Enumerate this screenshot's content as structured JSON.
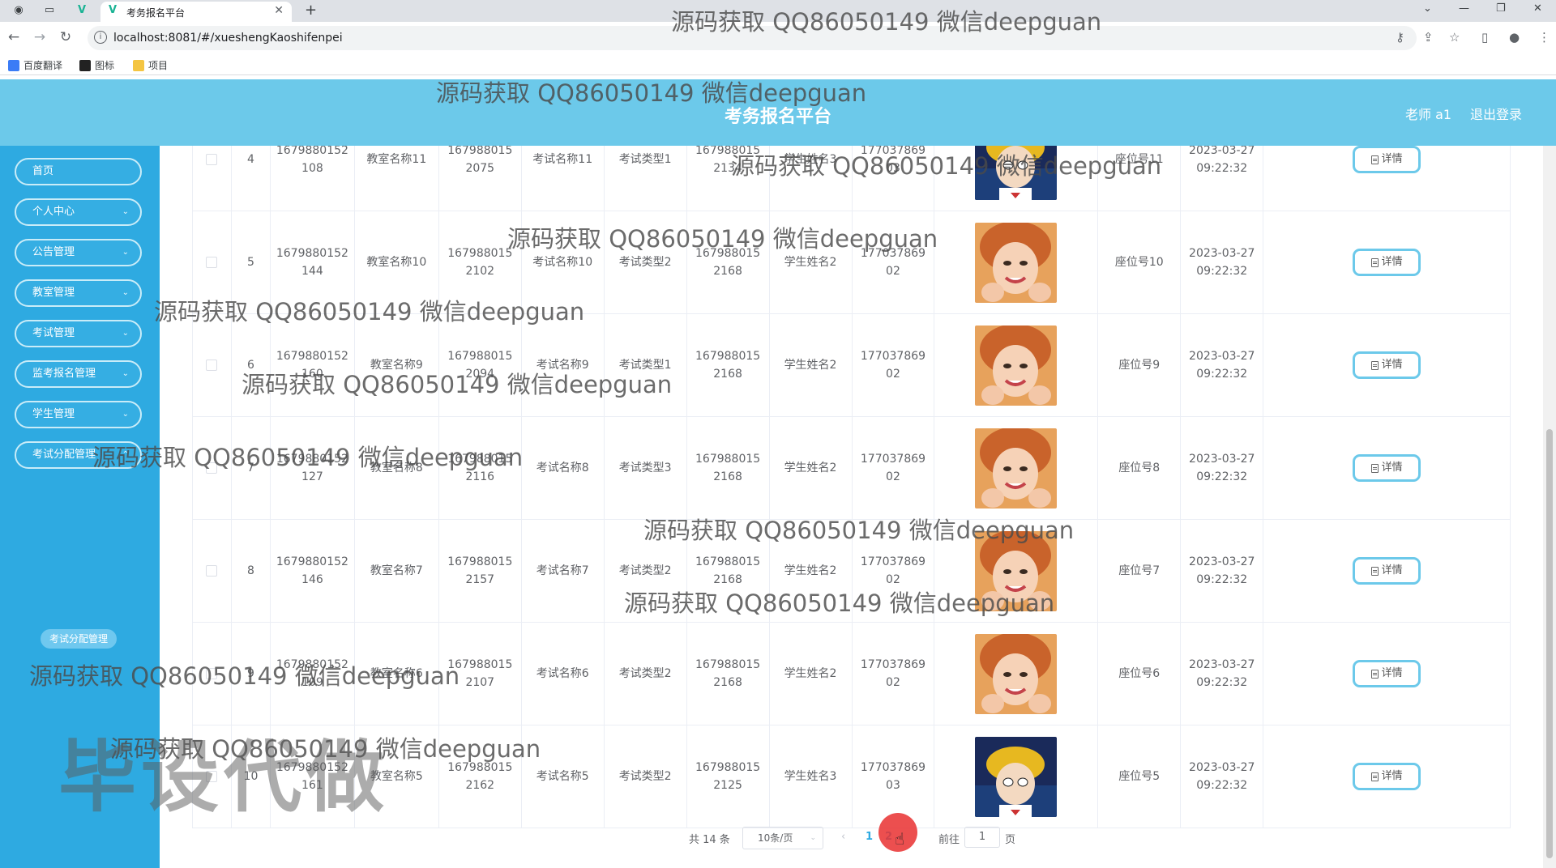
{
  "browser": {
    "tab_title": "考务报名平台",
    "url": "localhost:8081/#/xueshengKaoshifenpei",
    "bookmarks": [
      "百度翻译",
      "图标",
      "项目"
    ]
  },
  "header": {
    "title": "考务报名平台",
    "user_label": "老师 a1",
    "logout_label": "退出登录"
  },
  "sidebar": {
    "items": [
      {
        "label": "首页",
        "has_children": false
      },
      {
        "label": "个人中心",
        "has_children": true
      },
      {
        "label": "公告管理",
        "has_children": true
      },
      {
        "label": "教室管理",
        "has_children": true
      },
      {
        "label": "考试管理",
        "has_children": true
      },
      {
        "label": "监考报名管理",
        "has_children": true
      },
      {
        "label": "学生管理",
        "has_children": true
      },
      {
        "label": "考试分配管理",
        "has_children": true
      }
    ],
    "sub_item": "考试分配管理"
  },
  "table": {
    "detail_label": "详情",
    "rows": [
      {
        "index": "4",
        "c1": "1679880152\n108",
        "c2": "教室名称11",
        "c3": "167988015\n2075",
        "c4": "考试名称11",
        "c5": "考试类型1",
        "c6": "167988015\n2134",
        "c7": "学生姓名3",
        "c8": "177037869\n03",
        "photo": "boy",
        "seat": "座位号11",
        "time": "2023-03-27\n09:22:32"
      },
      {
        "index": "5",
        "c1": "1679880152\n144",
        "c2": "教室名称10",
        "c3": "167988015\n2102",
        "c4": "考试名称10",
        "c5": "考试类型2",
        "c6": "167988015\n2168",
        "c7": "学生姓名2",
        "c8": "177037869\n02",
        "photo": "girl",
        "seat": "座位号10",
        "time": "2023-03-27\n09:22:32"
      },
      {
        "index": "6",
        "c1": "1679880152\n160",
        "c2": "教室名称9",
        "c3": "167988015\n2094",
        "c4": "考试名称9",
        "c5": "考试类型1",
        "c6": "167988015\n2168",
        "c7": "学生姓名2",
        "c8": "177037869\n02",
        "photo": "girl",
        "seat": "座位号9",
        "time": "2023-03-27\n09:22:32"
      },
      {
        "index": "7",
        "c1": "1679880152\n127",
        "c2": "教室名称8",
        "c3": "167988015\n2116",
        "c4": "考试名称8",
        "c5": "考试类型3",
        "c6": "167988015\n2168",
        "c7": "学生姓名2",
        "c8": "177037869\n02",
        "photo": "girl",
        "seat": "座位号8",
        "time": "2023-03-27\n09:22:32"
      },
      {
        "index": "8",
        "c1": "1679880152\n146",
        "c2": "教室名称7",
        "c3": "167988015\n2157",
        "c4": "考试名称7",
        "c5": "考试类型2",
        "c6": "167988015\n2168",
        "c7": "学生姓名2",
        "c8": "177037869\n02",
        "photo": "girl",
        "seat": "座位号7",
        "time": "2023-03-27\n09:22:32"
      },
      {
        "index": "9",
        "c1": "1679880152\n109",
        "c2": "教室名称6",
        "c3": "167988015\n2107",
        "c4": "考试名称6",
        "c5": "考试类型2",
        "c6": "167988015\n2168",
        "c7": "学生姓名2",
        "c8": "177037869\n02",
        "photo": "girl",
        "seat": "座位号6",
        "time": "2023-03-27\n09:22:32"
      },
      {
        "index": "10",
        "c1": "1679880152\n161",
        "c2": "教室名称5",
        "c3": "167988015\n2162",
        "c4": "考试名称5",
        "c5": "考试类型2",
        "c6": "167988015\n2125",
        "c7": "学生姓名3",
        "c8": "177037869\n03",
        "photo": "boy",
        "seat": "座位号5",
        "time": "2023-03-27\n09:22:32"
      }
    ]
  },
  "pagination": {
    "total_label": "共 14 条",
    "page_size_label": "10条/页",
    "prev": "‹",
    "pages": [
      "1",
      "2"
    ],
    "current_page": "2",
    "goto_label": "前往",
    "goto_value": "1",
    "page_unit": "页"
  },
  "watermark": {
    "text": "源码获取 QQ86050149 微信deepguan",
    "big_text": "毕设代做"
  },
  "colors": {
    "header_bg": "#6cc9ea",
    "sidebar_bg": "#2eaae1",
    "button_border": "#6cc9ea"
  }
}
